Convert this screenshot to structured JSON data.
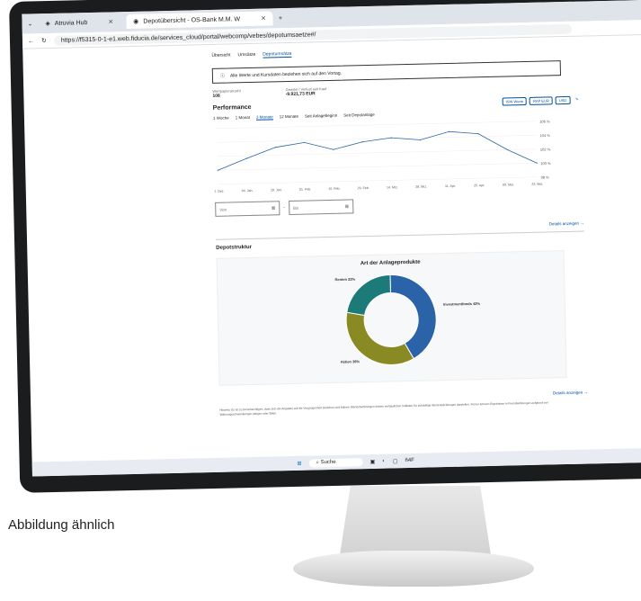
{
  "browser": {
    "tabs": [
      {
        "label": "Atruvia Hub"
      },
      {
        "label": "Depotübersicht - OS-Bank M.M. W"
      }
    ],
    "url": "https://f5315-0-1-e1.web.fiducia.de/services_cloud/portal/webcomp/vebes/depotumsaetze#/"
  },
  "subnav": [
    "Übersicht",
    "Umsätze",
    "Depotumsätze"
  ],
  "info_text": "Alle Werte und Kursdaten beziehen sich auf den Vortag.",
  "kv": [
    {
      "label": "Wertpapieranzahl",
      "value": "108"
    },
    {
      "label": "Gewinn / Verlust seit Kauf",
      "value": "-9.921,73 EUR"
    }
  ],
  "performance": {
    "title": "Performance",
    "buttons": [
      "ISIN Werte",
      "RAP EUR",
      "USD"
    ],
    "ranges": [
      "1 Woche",
      "1 Monat",
      "3 Monate",
      "12 Monate",
      "Seit Anlagebeginn",
      "Seit Depotanlage"
    ],
    "date_from_placeholder": "Von",
    "date_to_placeholder": "Bis",
    "details_link": "Details anzeigen"
  },
  "depotstruktur": {
    "title": "Depotstruktur",
    "details_link": "Details anzeigen"
  },
  "footnote": "Hinweis: Es ist zu berücksichtigen, dass sich die Angaben auf die Vergangenheit beziehen und frühere Wertentwicklungen keinen verlässlichen Indikator für zukünftige Wertentwicklungen darstellen. Ferner können Ergebnisse in Fremdwährungen aufgrund von Währungsschwankungen steigen oder fallen.",
  "taskbar": {
    "search": "Suche",
    "hint": "ñ4F"
  },
  "caption": "Abbildung ähnlich",
  "colors": {
    "accent": "#0050a0",
    "teal": "#1c7a78",
    "olive": "#8a8a25",
    "blue": "#2a63a8"
  },
  "chart_data": [
    {
      "type": "line",
      "title": "",
      "x": [
        "20. Dez.",
        "04. Jan.",
        "18. Jan.",
        "01. Feb.",
        "15. Feb.",
        "29. Feb.",
        "14. Mrz.",
        "28. Mrz.",
        "11. Apr.",
        "25. Apr.",
        "09. Mai.",
        "23. Mai."
      ],
      "series": [
        {
          "values": [
            100,
            101.6,
            103.1,
            103.7,
            102.6,
            103.6,
            104.1,
            103.7,
            104.8,
            104.4,
            102.0,
            100.0
          ]
        }
      ],
      "ylim": [
        98,
        106
      ],
      "yticks": [
        "106 %",
        "104 %",
        "102 %",
        "100 %",
        "98 %"
      ]
    },
    {
      "type": "pie",
      "title": "Art der Anlageprodukte",
      "categories": [
        "Investmentfonds",
        "Aktien",
        "Renten"
      ],
      "values": [
        42,
        36,
        22
      ],
      "labels": [
        "Investmentfonds 42%",
        "Aktien 36%",
        "Renten 22%"
      ]
    }
  ]
}
